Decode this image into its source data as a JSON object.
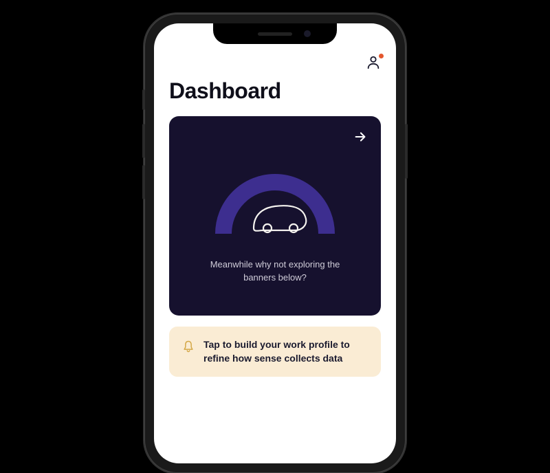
{
  "header": {
    "title": "Dashboard"
  },
  "hero_card": {
    "message": "Meanwhile why not exploring the banners below?"
  },
  "banner": {
    "text": "Tap to build your work profile to refine how sense collects data"
  },
  "colors": {
    "gauge_arc": "#3d2e8f",
    "card_bg": "#16112e",
    "banner_bg": "#faecd4",
    "notification_dot": "#e4572e"
  }
}
